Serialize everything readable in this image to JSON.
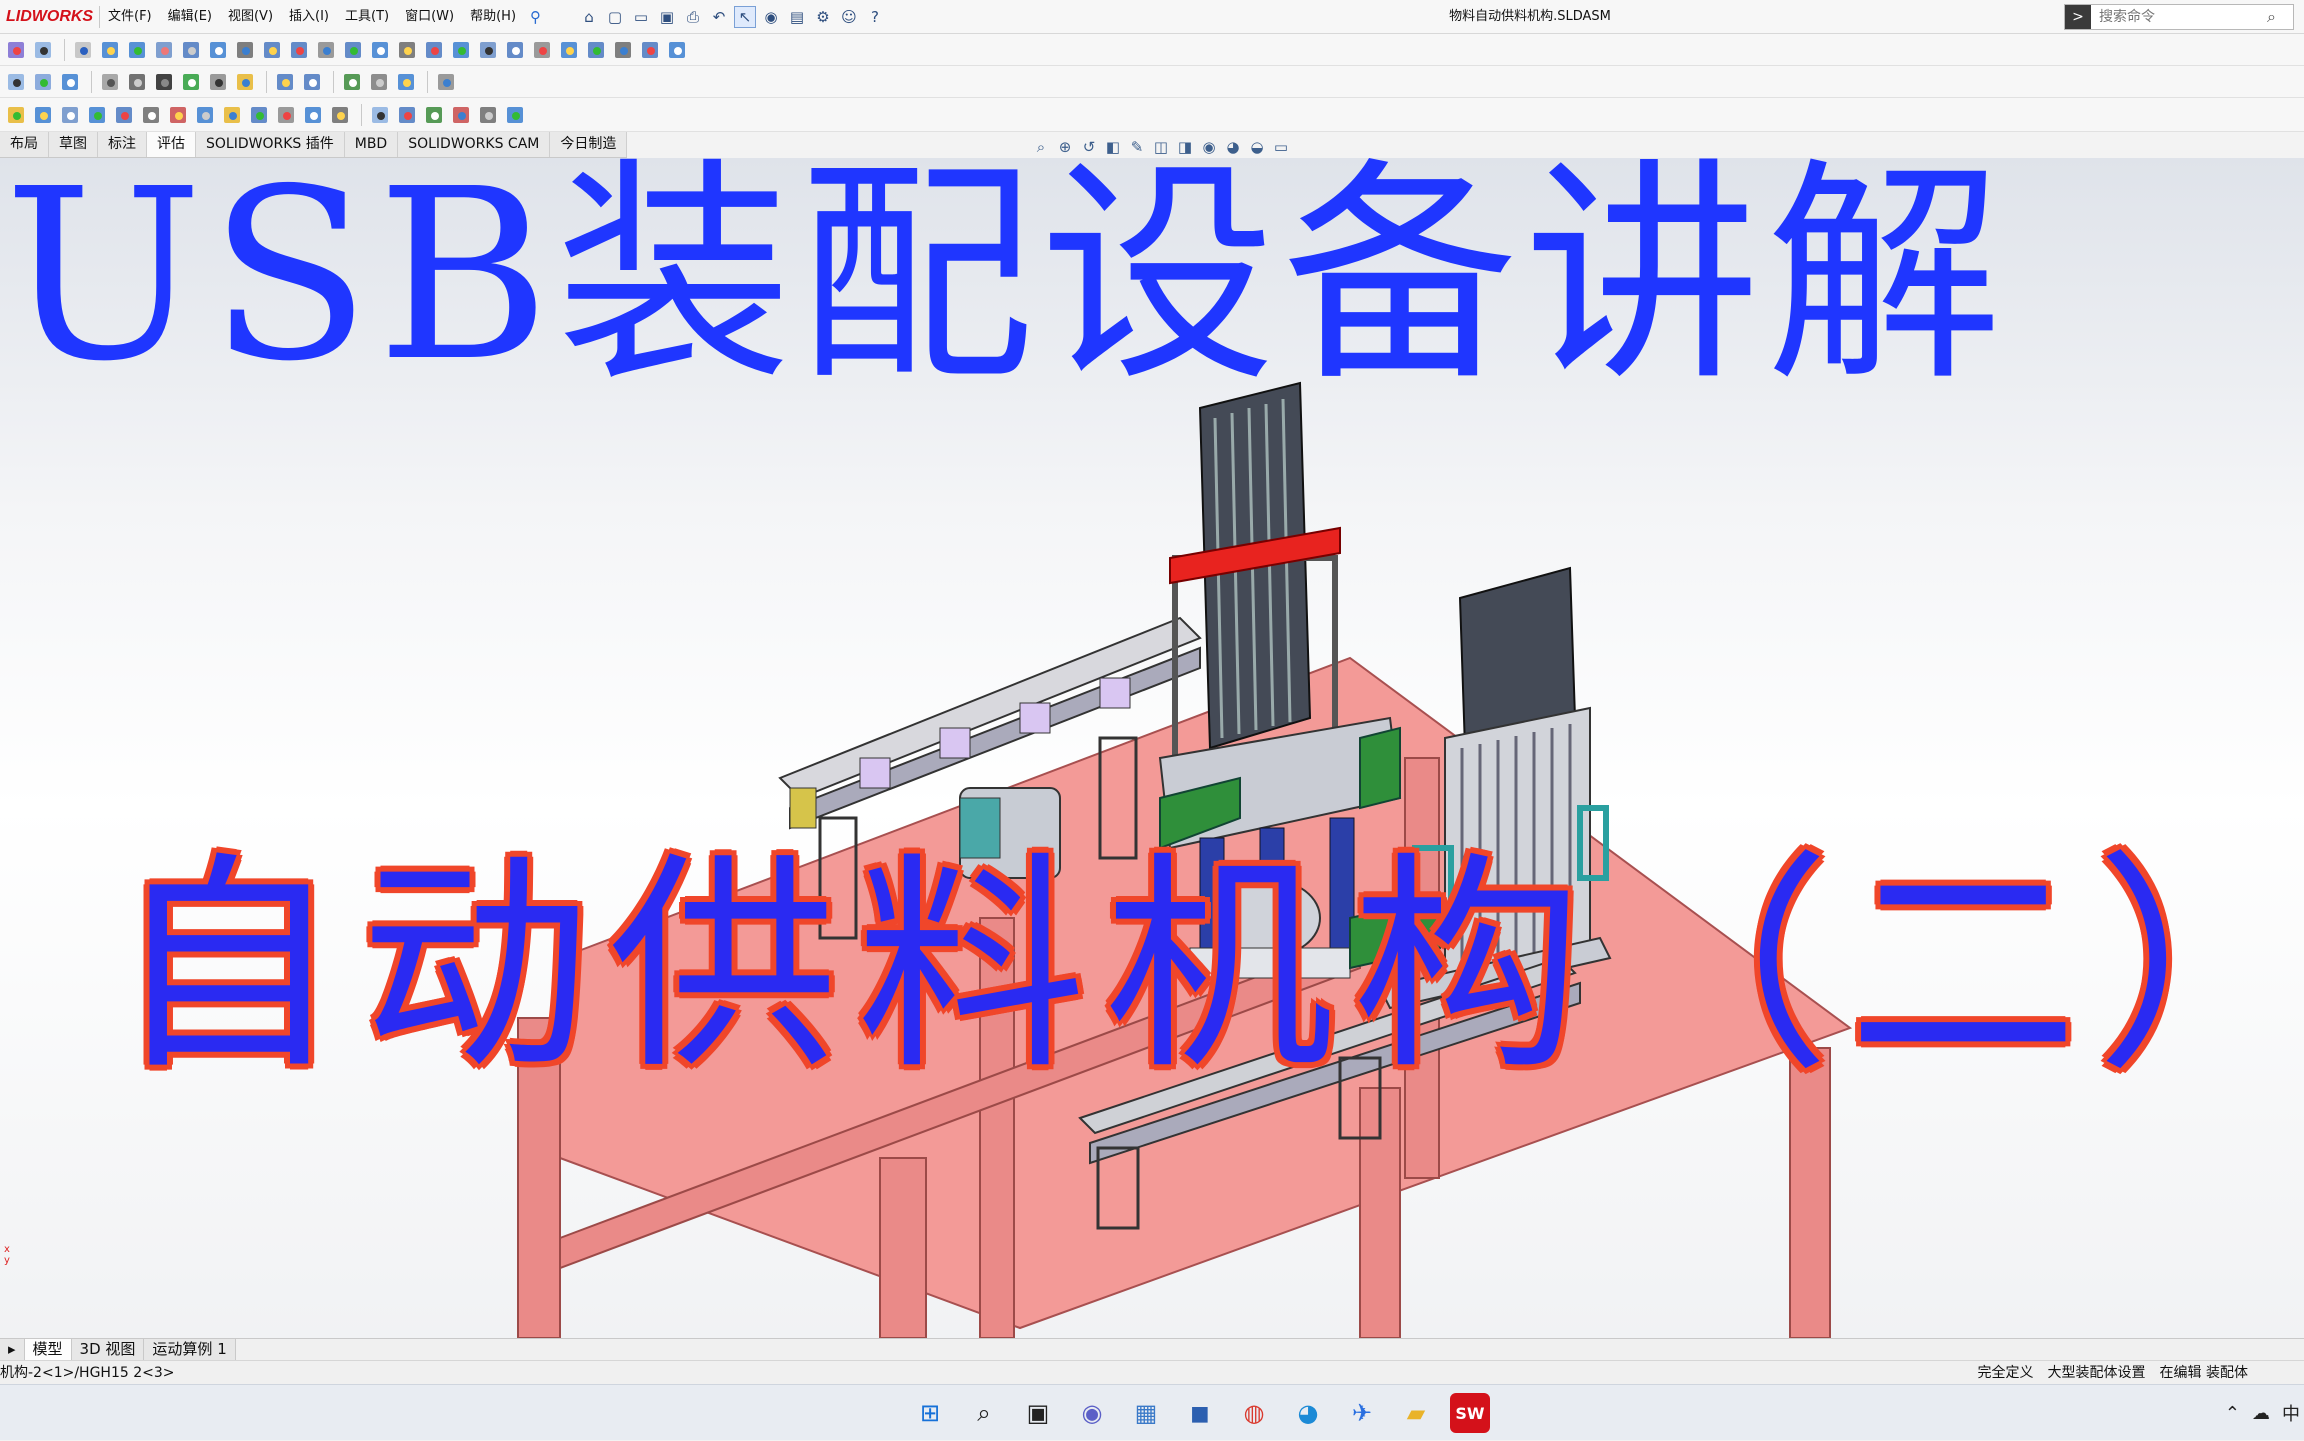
{
  "app": {
    "logo_text": "LIDWORKS",
    "document_title": "物料自动供料机构.SLDASM"
  },
  "menu": [
    "文件(F)",
    "编辑(E)",
    "视图(V)",
    "插入(I)",
    "工具(T)",
    "窗口(W)",
    "帮助(H)"
  ],
  "search": {
    "placeholder": "搜索命令"
  },
  "tabs": [
    "布局",
    "草图",
    "标注",
    "评估",
    "SOLIDWORKS 插件",
    "MBD",
    "SOLIDWORKS CAM",
    "今日制造"
  ],
  "active_tab": "评估",
  "overlay": {
    "title_top": "USB装配设备讲解",
    "title_bottom": "自动供料机构（二）"
  },
  "triad": {
    "x": "x",
    "y": "y"
  },
  "bottom_tabs": [
    "模型",
    "3D 视图",
    "运动算例 1"
  ],
  "status": {
    "left": "机构-2<1>/HGH15 2<3>",
    "right": [
      "完全定义",
      "大型装配体设置",
      "在编辑 装配体"
    ]
  },
  "tray": {
    "ime": "中"
  },
  "colors": {
    "title_blue": "#1f36ff",
    "outline_red": "#f0462a",
    "table": "#f39a97",
    "brand_red": "#d4111a"
  }
}
